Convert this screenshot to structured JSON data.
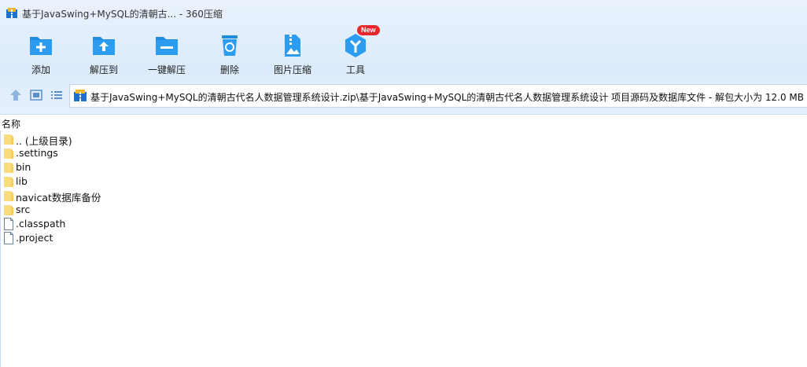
{
  "window": {
    "title": "基于JavaSwing+MySQL的清朝古...  - 360压缩"
  },
  "toolbar": {
    "items": [
      {
        "label": "添加",
        "icon": "add-folder-icon"
      },
      {
        "label": "解压到",
        "icon": "extract-to-icon"
      },
      {
        "label": "一键解压",
        "icon": "one-click-extract-icon"
      },
      {
        "label": "删除",
        "icon": "delete-bin-icon"
      },
      {
        "label": "图片压缩",
        "icon": "image-compress-icon"
      },
      {
        "label": "工具",
        "icon": "tools-icon"
      }
    ],
    "badge": "New"
  },
  "navbar": {
    "path": "基于JavaSwing+MySQL的清朝古代名人数据管理系统设计.zip\\基于JavaSwing+MySQL的清朝古代名人数据管理系统设计 项目源码及数据库文件 - 解包大小为 12.0 MB"
  },
  "list": {
    "column_name": "名称",
    "rows": [
      {
        "name": ".. (上级目录)",
        "type": "folder"
      },
      {
        "name": ".settings",
        "type": "folder"
      },
      {
        "name": "bin",
        "type": "folder"
      },
      {
        "name": "lib",
        "type": "folder"
      },
      {
        "name": "navicat数据库备份",
        "type": "folder"
      },
      {
        "name": "src",
        "type": "folder"
      },
      {
        "name": ".classpath",
        "type": "file"
      },
      {
        "name": ".project",
        "type": "file"
      }
    ]
  },
  "colors": {
    "accent_blue": "#1e8de0",
    "folder_yellow": "#f6cf5c",
    "badge_red": "#e8262b"
  }
}
